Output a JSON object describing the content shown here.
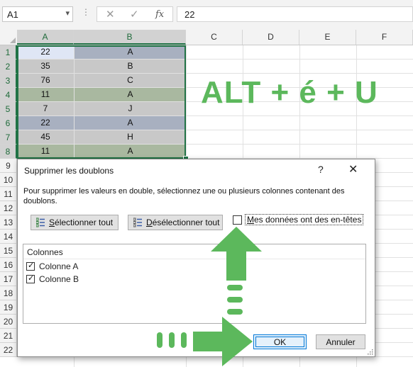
{
  "formula_bar": {
    "name_box": "A1",
    "name_box_arrow": "▾",
    "separator": "⋮",
    "cancel_glyph": "✕",
    "enter_glyph": "✓",
    "fx_glyph": "fx",
    "formula_value": "22"
  },
  "columns": [
    "A",
    "B",
    "C",
    "D",
    "E",
    "F"
  ],
  "rows": [
    "1",
    "2",
    "3",
    "4",
    "5",
    "6",
    "7",
    "8",
    "9",
    "10",
    "11",
    "12",
    "13",
    "14",
    "15",
    "16",
    "17",
    "18",
    "19",
    "20",
    "21",
    "22"
  ],
  "cells": [
    {
      "a": "22",
      "b": "A"
    },
    {
      "a": "35",
      "b": "B"
    },
    {
      "a": "76",
      "b": "C"
    },
    {
      "a": "11",
      "b": "A"
    },
    {
      "a": "7",
      "b": "J"
    },
    {
      "a": "22",
      "b": "A"
    },
    {
      "a": "45",
      "b": "H"
    },
    {
      "a": "11",
      "b": "A"
    }
  ],
  "colors": {
    "accent_green": "#217346",
    "highlight_blue_grey": "#a8b0c0",
    "highlight_sage": "#a9b8a0",
    "highlight_grey": "#c8c8c8",
    "active_cell": "#dfe6f5",
    "arrow_green": "#5cb85c"
  },
  "shortcut_text": "ALT + é + U",
  "dialog": {
    "title": "Supprimer les doublons",
    "help_glyph": "?",
    "close_glyph": "✕",
    "description": "Pour supprimer les valeurs en double, sélectionnez une ou plusieurs colonnes contenant des doublons.",
    "select_all_label_u": "S",
    "select_all_label_rest": "électionner tout",
    "deselect_all_label_u": "D",
    "deselect_all_label_rest": "ésélectionner tout",
    "headers_label_u": "M",
    "headers_label_rest": "es données ont des en-têtes",
    "headers_checked": false,
    "columns_title": "Colonnes",
    "column_items": [
      {
        "label": "Colonne A",
        "checked": true
      },
      {
        "label": "Colonne B",
        "checked": true
      }
    ],
    "ok_label": "OK",
    "cancel_label": "Annuler"
  },
  "icons": [
    "select-all-icon",
    "deselect-all-icon",
    "up-arrow-icon",
    "right-arrow-icon",
    "close-icon",
    "help-icon",
    "fx-icon"
  ]
}
